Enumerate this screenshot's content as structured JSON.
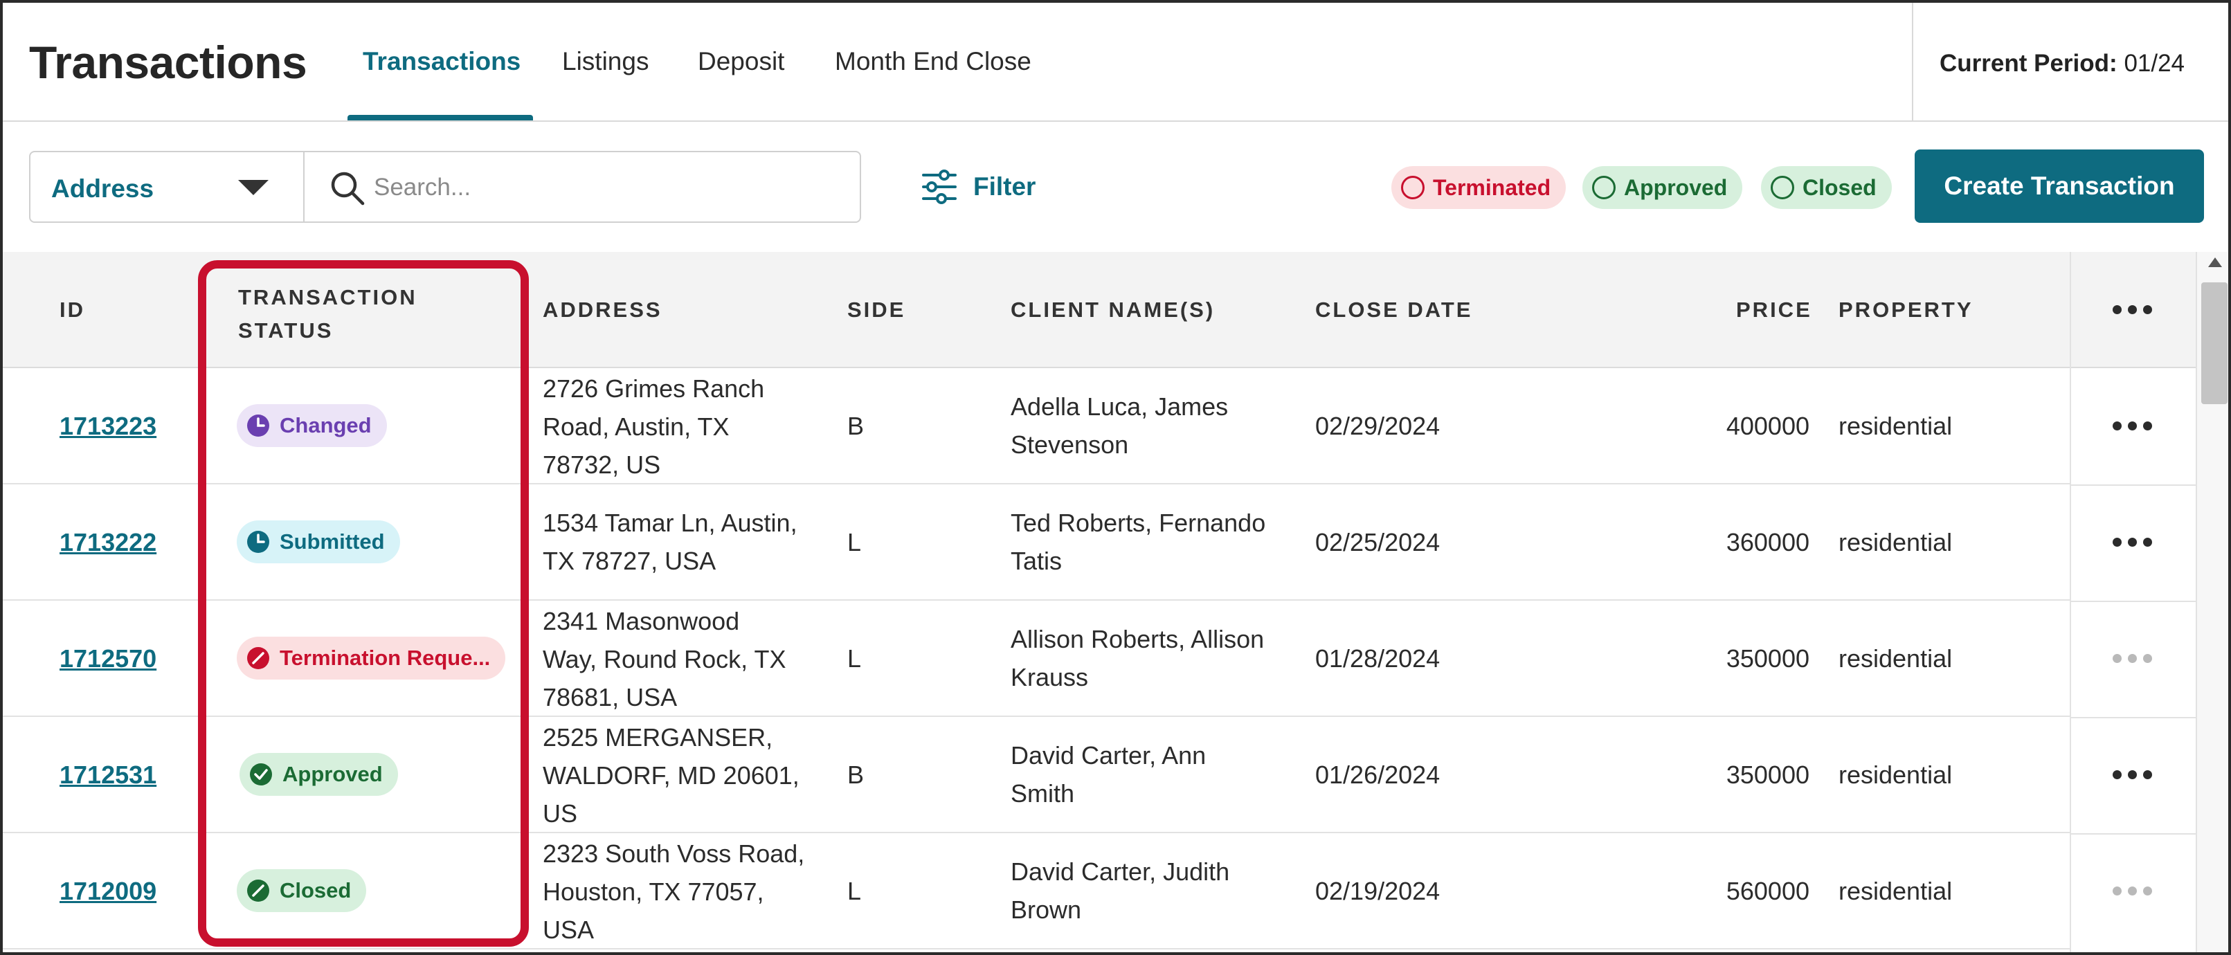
{
  "header": {
    "title": "Transactions",
    "tabs": [
      {
        "label": "Transactions",
        "active": true
      },
      {
        "label": "Listings",
        "active": false
      },
      {
        "label": "Deposit",
        "active": false
      },
      {
        "label": "Month End Close",
        "active": false
      }
    ],
    "period_label": "Current Period:",
    "period_value": "01/24"
  },
  "toolbar": {
    "field_select": "Address",
    "search_placeholder": "Search...",
    "filter_label": "Filter",
    "chips": [
      {
        "label": "Terminated",
        "color": "#c8102e"
      },
      {
        "label": "Approved",
        "color": "#1b6b34"
      },
      {
        "label": "Closed",
        "color": "#1b6b34"
      }
    ],
    "create_label": "Create Transaction"
  },
  "table": {
    "columns": {
      "id": "ID",
      "status_line1": "TRANSACTION",
      "status_line2": "STATUS",
      "address": "ADDRESS",
      "side": "SIDE",
      "clients": "CLIENT NAME(S)",
      "close_date": "CLOSE DATE",
      "price": "PRICE",
      "property": "PROPERTY"
    },
    "rows": [
      {
        "id": "1713223",
        "status": "Changed",
        "status_icon": "clock-icon",
        "address": [
          "2726 Grimes Ranch",
          "Road, Austin, TX",
          "78732, US"
        ],
        "side": "B",
        "clients": [
          "Adella Luca, James",
          "Stevenson"
        ],
        "close_date": "02/29/2024",
        "price": "400000",
        "property": "residential"
      },
      {
        "id": "1713222",
        "status": "Submitted",
        "status_icon": "clock-icon",
        "address": [
          "1534 Tamar Ln, Austin,",
          "TX 78727, USA"
        ],
        "side": "L",
        "clients": [
          "Ted Roberts, Fernando",
          "Tatis"
        ],
        "close_date": "02/25/2024",
        "price": "360000",
        "property": "residential"
      },
      {
        "id": "1712570",
        "status": "Termination Reque...",
        "status_icon": "slash-circle-icon",
        "address": [
          "2341 Masonwood",
          "Way, Round Rock, TX",
          "78681, USA"
        ],
        "side": "L",
        "clients": [
          "Allison Roberts, Allison",
          "Krauss"
        ],
        "close_date": "01/28/2024",
        "price": "350000",
        "property": "residential"
      },
      {
        "id": "1712531",
        "status": "Approved",
        "status_icon": "check-circle-icon",
        "address": [
          "2525 MERGANSER,",
          "WALDORF, MD 20601,",
          "US"
        ],
        "side": "B",
        "clients": [
          "David Carter, Ann",
          "Smith"
        ],
        "close_date": "01/26/2024",
        "price": "350000",
        "property": "residential"
      },
      {
        "id": "1712009",
        "status": "Closed",
        "status_icon": "slash-circle-icon",
        "address": [
          "2323 South Voss Road,",
          "Houston, TX 77057,",
          "USA"
        ],
        "side": "L",
        "clients": [
          "David Carter, Judith",
          "Brown"
        ],
        "close_date": "02/19/2024",
        "price": "560000",
        "property": "residential"
      }
    ]
  },
  "colors": {
    "accent": "#0e6b80",
    "highlight": "#c8102e"
  }
}
